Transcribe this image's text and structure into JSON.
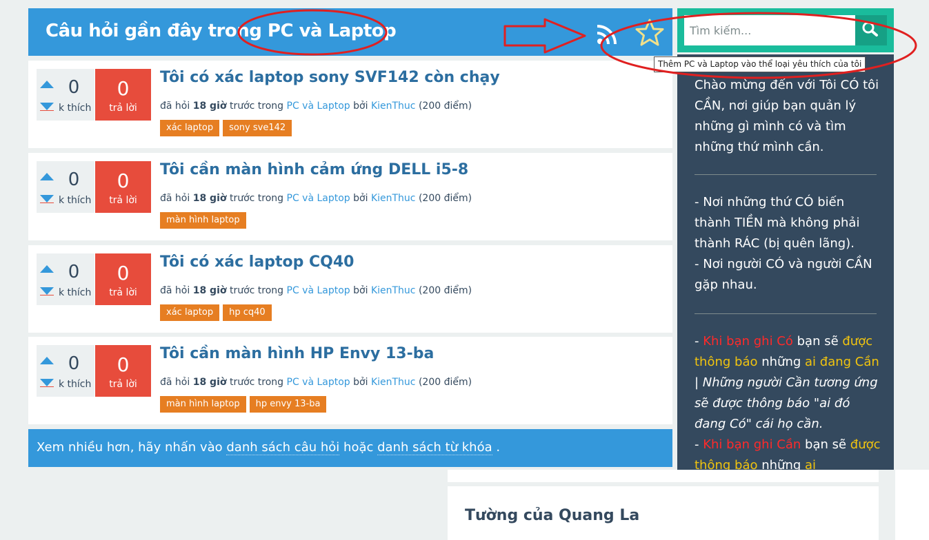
{
  "header": {
    "title": "Câu hỏi gần đây trong PC và Laptop"
  },
  "vote_label": "k thích",
  "answer_label": "trả lời",
  "meta_template": {
    "asked": "đã hỏi",
    "time": "18 giờ",
    "ago_in": "trước trong",
    "by": "bởi",
    "points": "(200 điểm)"
  },
  "questions": [
    {
      "title": "Tôi có xác laptop sony SVF142 còn chạy",
      "votes": "0",
      "answers": "0",
      "category": "PC và Laptop",
      "author": "KienThuc",
      "tags": [
        "xác laptop",
        "sony sve142"
      ]
    },
    {
      "title": "Tôi cần màn hình cảm ứng DELL i5-8",
      "votes": "0",
      "answers": "0",
      "category": "PC và Laptop",
      "author": "KienThuc",
      "tags": [
        "màn hình laptop"
      ]
    },
    {
      "title": "Tôi có xác laptop CQ40",
      "votes": "0",
      "answers": "0",
      "category": "PC và Laptop",
      "author": "KienThuc",
      "tags": [
        "xác laptop",
        "hp cq40"
      ]
    },
    {
      "title": "Tôi cần màn hình HP Envy 13-ba",
      "votes": "0",
      "answers": "0",
      "category": "PC và Laptop",
      "author": "KienThuc",
      "tags": [
        "màn hình laptop",
        "hp envy 13-ba"
      ]
    }
  ],
  "more": {
    "prefix": "Xem nhiều hơn, hãy nhấn vào",
    "link1": "danh sách câu hỏi",
    "middle": "hoặc",
    "link2": "danh sách từ khóa",
    "suffix": "."
  },
  "search": {
    "placeholder": "Tìm kiếm..."
  },
  "tooltip": "Thêm  PC và Laptop vào thể loại yêu thích của tôi",
  "sidebar": {
    "intro": "Chào mừng đến với Tôi CÓ tôi CẦN, nơi giúp bạn quản lý những gì mình có và tìm những thứ mình cần.",
    "p1": "- Nơi những thứ CÓ biến thành TIỀN mà không phải thành RÁC (bị quên lãng).",
    "p2": "- Nơi người CÓ và người CẦN gặp nhau.",
    "b1_dash": "- ",
    "b1_red": "Khi bạn ghi Có",
    "b1_white": " bạn sẽ ",
    "b1_yellow": "được thông báo",
    "b1_white2": " những ",
    "b1_yellow2": "ai đang Cần",
    "b1_sep": " | ",
    "b1_italic": "Những người Cần tương ứng sẽ được thông báo \"ai đó đang Có\" cái họ cần.",
    "b2_dash": "- ",
    "b2_red": "Khi bạn ghi Cần",
    "b2_white": " bạn sẽ ",
    "b2_yellow": "được thông báo",
    "b2_white2": " những ",
    "b2_yellow2": "ai"
  },
  "wall": {
    "title": "Tường của Quang La"
  },
  "icons": {
    "feed": "rss-icon",
    "favorite": "star-icon",
    "search": "magnifier-icon"
  },
  "colors": {
    "header_blue": "#3498db",
    "answer_red": "#e74c3c",
    "tag_orange": "#e67e22",
    "sidebar": "#34495e",
    "search_green": "#1abc9c"
  }
}
